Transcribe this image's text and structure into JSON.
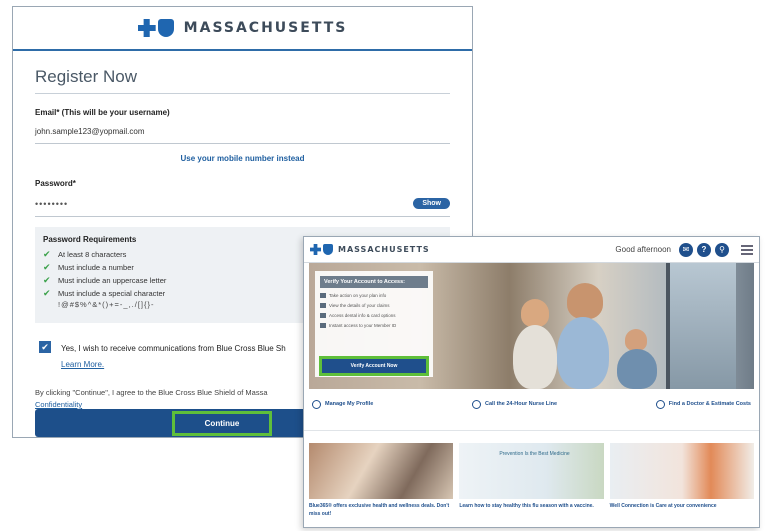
{
  "register": {
    "brand": "MASSACHUSETTS",
    "title": "Register Now",
    "email_label": "Email* (This will be your username)",
    "email_value": "john.sample123@yopmail.com",
    "mobile_link": "Use your mobile number instead",
    "password_label": "Password*",
    "password_value": "••••••••",
    "show_label": "Show",
    "requirements": {
      "title": "Password Requirements",
      "items": [
        "At least 8 characters",
        "Must include a number",
        "Must include an uppercase letter",
        "Must include a special character"
      ],
      "special_chars": "!@#$%^&*()+=-_,./[]{}-"
    },
    "consent_text": "Yes, I wish to receive communications from Blue Cross Blue Sh",
    "learn_more": "Learn More.",
    "terms_text": "By clicking \"Continue\", I agree to the Blue Cross Blue Shield of Massa",
    "terms_link": "Confidentiality",
    "continue_label": "Continue"
  },
  "home": {
    "brand": "MASSACHUSETTS",
    "greeting": "Good afternoon",
    "icons": [
      "chat-icon",
      "help-icon",
      "search-icon",
      "menu-icon"
    ],
    "verify_card": {
      "title": "Verify Your Account to Access:",
      "items": [
        "Take action on your plan info",
        "View the details of your claims",
        "Access dental info & card options",
        "Instant access to your Member ID"
      ],
      "button": "Verify Account Now"
    },
    "quick_links": [
      "Manage My Profile",
      "Call the 24-Hour Nurse Line",
      "Find a Doctor & Estimate Costs"
    ],
    "promo_text": "Prevention Is the Best Medicine",
    "cards": [
      {
        "caption": "Blue365® offers exclusive health and wellness deals. Don't miss out!"
      },
      {
        "caption": "Learn how to stay healthy this flu season with a vaccine."
      },
      {
        "caption": "Well Connection is Care at your convenience"
      }
    ]
  },
  "colors": {
    "brand_blue": "#1f66b0",
    "button_blue": "#1d4f8a",
    "highlight_green": "#5fbf3a"
  }
}
